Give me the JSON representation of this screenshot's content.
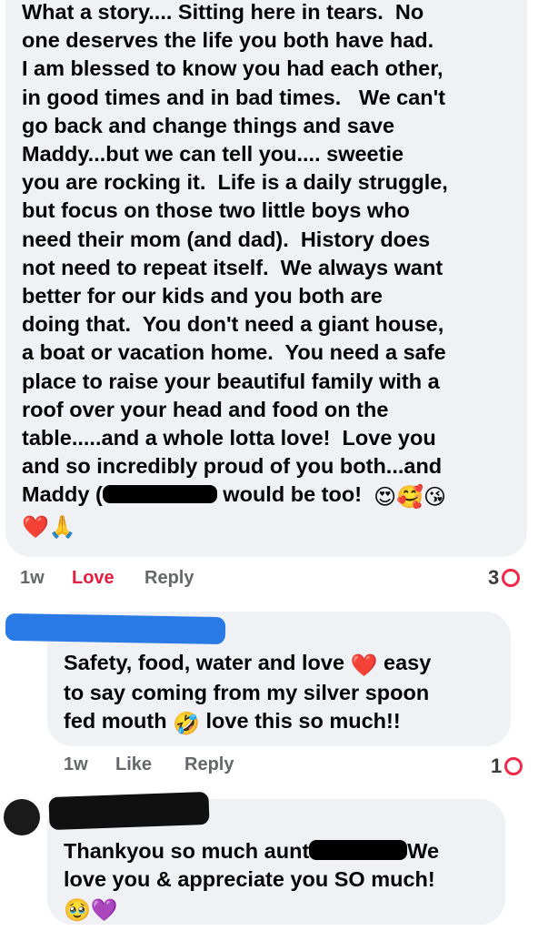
{
  "comments": [
    {
      "text_parts": [
        "What a story.... Sitting here in tears.  No\none deserves the life you both have had.\nI am blessed to know you had each other,\nin good times and in bad times.   We can't\ngo back and change things and save\nMaddy...but we can tell you.... sweetie\nyou are rocking it.  Life is a daily struggle,\nbut focus on those two little boys who\nneed their mom (and dad).  History does\nnot need to repeat itself.  We always want\nbetter for our kids and you both are\ndoing that.  You don't need a giant house,\na boat or vacation home.  You need a safe\nplace to raise your beautiful family with a\nroof over your head and food on the\ntable.....and a whole lotta love!  Love you\nand so incredibly proud of you both...and\nMaddy (",
        " would be too!  "
      ],
      "emojis": [
        "😍",
        "🥰",
        "😘",
        "❤️",
        "🙏"
      ],
      "time": "1w",
      "action_love": "Love",
      "action_reply": "Reply",
      "reaction_count": "3"
    },
    {
      "text_parts": [
        "Safety, food, water and love ",
        " easy\nto say coming from my silver spoon\nfed mouth ",
        " love this so much!!"
      ],
      "emojis": [
        "❤️",
        "🤣"
      ],
      "time": "1w",
      "action_like": "Like",
      "action_reply": "Reply",
      "reaction_count": "1"
    },
    {
      "text_parts": [
        "Thankyou so much aunt",
        "We\nlove you & appreciate you SO much!\n"
      ],
      "emojis": [
        "🥹",
        "💜"
      ]
    }
  ],
  "colors": {
    "bubble": "#eff1f4",
    "love_active": "#e41e3f",
    "meta_gray": "#65676b",
    "heart_ring": "#f02849"
  }
}
